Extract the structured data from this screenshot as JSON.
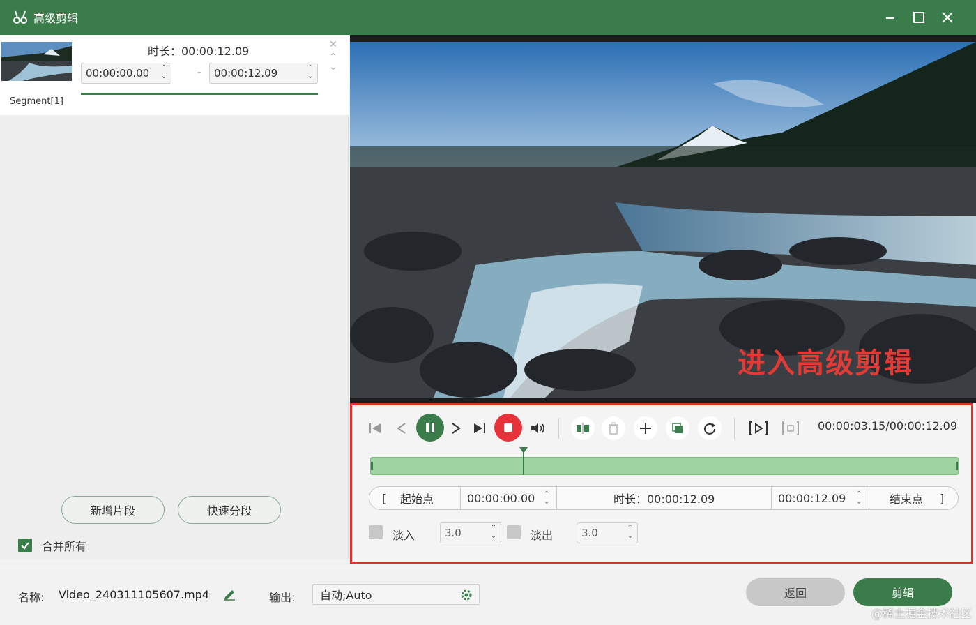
{
  "window": {
    "title": "高级剪辑",
    "minimize_icon": "minimize-icon",
    "maximize_icon": "maximize-icon",
    "close_icon": "close-icon"
  },
  "segment": {
    "label": "Segment[1]",
    "duration_text": "时长：00:00:12.09",
    "start": "00:00:00.00",
    "end": "00:00:12.09",
    "dash": "-"
  },
  "left_actions": {
    "add_segment": "新增片段",
    "quick_split": "快速分段",
    "merge_all": "合并所有",
    "merge_checked": true
  },
  "preview": {
    "overlay_text": "进入高级剪辑"
  },
  "player": {
    "time_readout": "00:00:03.15/00:00:12.09",
    "playhead_fraction": 0.2605,
    "range": {
      "start_label": "起始点",
      "start_value": "00:00:00.00",
      "duration": "时长：00:00:12.09",
      "end_value": "00:00:12.09",
      "end_label": "结束点",
      "open_bracket": "[",
      "close_bracket": "]"
    },
    "fade_in_label": "淡入",
    "fade_in_value": "3.0",
    "fade_out_label": "淡出",
    "fade_out_value": "3.0"
  },
  "bottom": {
    "name_label": "名称:",
    "name_value": "Video_240311105607.mp4",
    "output_label": "输出:",
    "output_value": "自动;Auto",
    "back_button": "返回",
    "cut_button": "剪辑"
  },
  "watermark": "@稀土掘金技术社区",
  "colors": {
    "brand_green": "#3a7d4a",
    "track_green": "#9fd39f",
    "highlight_red": "#e0302b",
    "stop_red": "#e8323a"
  }
}
